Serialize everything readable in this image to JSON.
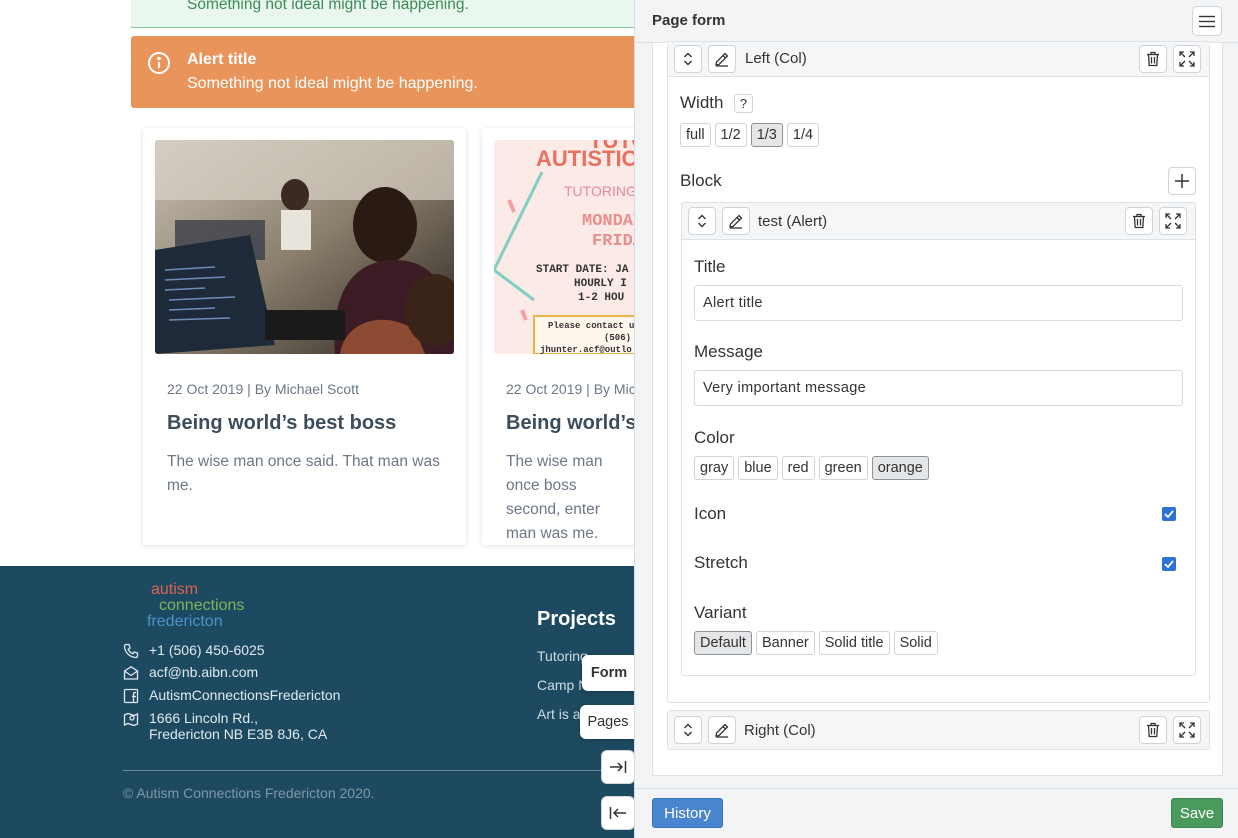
{
  "site": {
    "alerts": [
      {
        "message": "Something not ideal might be happening."
      },
      {
        "title": "Alert title",
        "message": "Something not ideal might be happening."
      }
    ],
    "posts": [
      {
        "meta": "22 Oct 2019 | By Michael Scott",
        "title": "Being world’s best boss",
        "excerpt": "The wise man once said. That man was me."
      },
      {
        "meta": "22 Oct 2019 | By Mic",
        "title": "Being world’s b",
        "excerpt": "The wise man once boss second, enter man was me."
      }
    ],
    "poster": {
      "line1": "TUTOR",
      "line2": "AUTISTIC",
      "line3": "TUTORING",
      "line4": "MONDAY:",
      "line5": "FRIDAY:",
      "line6": "START DATE: JA",
      "line7": "HOURLY I",
      "line8": "1-2 HOU",
      "line9": "Please contact us",
      "line10": "(506)",
      "line11": "jhunter.acf@outlo"
    },
    "footer": {
      "logo": {
        "line1": "autism",
        "line2": "connections",
        "line3": "fredericton"
      },
      "phone": "+1 (506) 450-6025",
      "email": "acf@nb.aibn.com",
      "facebook": "AutismConnectionsFredericton",
      "address_line1": "1666 Lincoln Rd.,",
      "address_line2": "Fredericton NB E3B 8J6, CA",
      "projects_title": "Projects",
      "project_links": [
        "Tutoring",
        "Camp N",
        "Art is a"
      ],
      "copyright": "© Autism Connections Fredericton 2020."
    },
    "float_tabs": {
      "form": "Form",
      "pages": "Pages"
    }
  },
  "panel": {
    "title": "Page form",
    "left_col": {
      "label": "Left (Col)"
    },
    "width": {
      "label": "Width",
      "help": "?",
      "options": [
        "full",
        "1/2",
        "1/3",
        "1/4"
      ],
      "selected": "1/3"
    },
    "block": {
      "label": "Block"
    },
    "alert_block": {
      "label": "test (Alert)",
      "title_label": "Title",
      "title_value": "Alert title",
      "message_label": "Message",
      "message_value": "Very important message",
      "color_label": "Color",
      "color_options": [
        "gray",
        "blue",
        "red",
        "green",
        "orange"
      ],
      "color_selected": "orange",
      "icon_label": "Icon",
      "icon_checked": true,
      "stretch_label": "Stretch",
      "stretch_checked": true,
      "variant_label": "Variant",
      "variant_options": [
        "Default",
        "Banner",
        "Solid title",
        "Solid"
      ],
      "variant_selected": "Default"
    },
    "right_col": {
      "label": "Right (Col)"
    },
    "history_button": "History",
    "save_button": "Save"
  },
  "colors": {
    "orange_alert": "#e8945a",
    "footer_bg": "#1d4a60",
    "history_blue": "#4a86cf",
    "save_green": "#4a9a5e",
    "checkbox_blue": "#2f72d6"
  }
}
